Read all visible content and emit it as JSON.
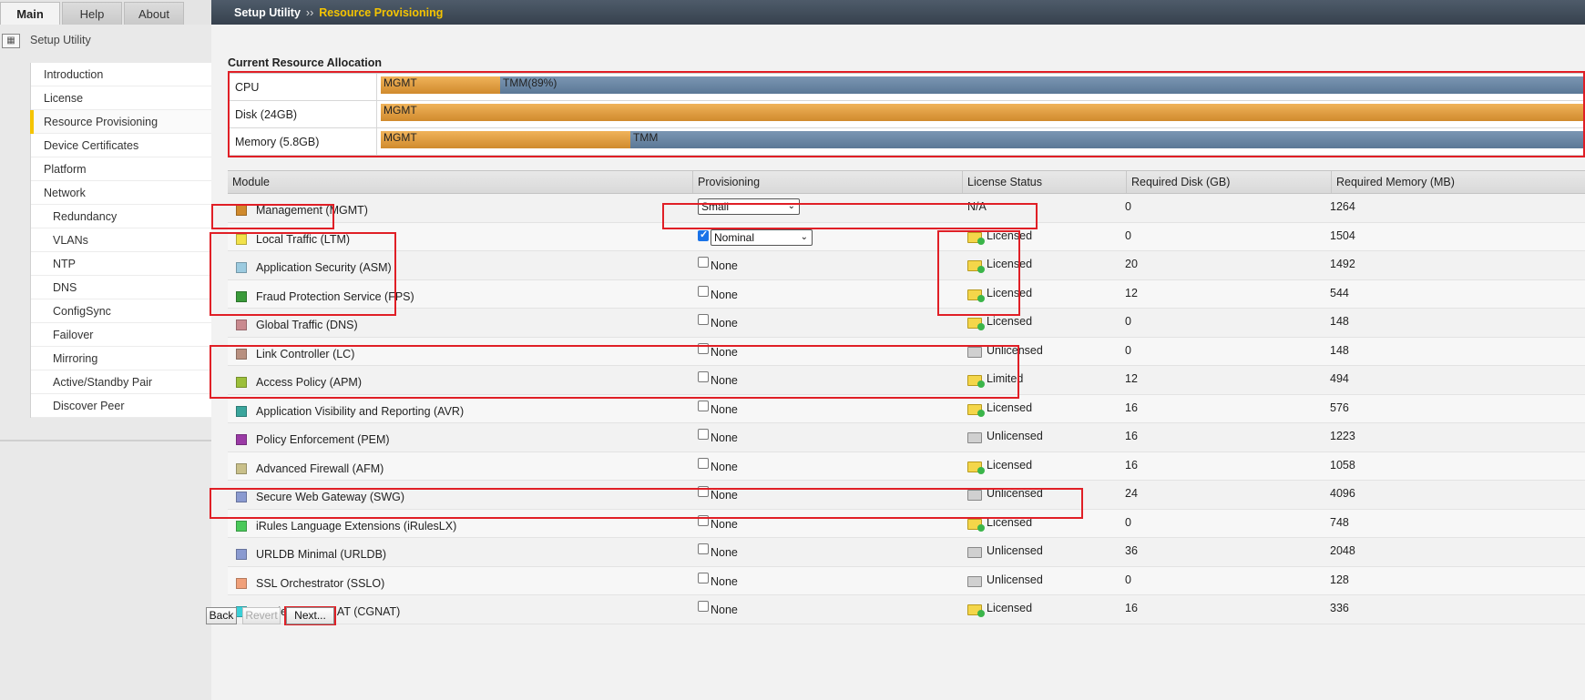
{
  "tabs": {
    "main": "Main",
    "help": "Help",
    "about": "About"
  },
  "sidebar": {
    "title": "Setup Utility",
    "items": [
      {
        "label": "Introduction"
      },
      {
        "label": "License"
      },
      {
        "label": "Resource Provisioning"
      },
      {
        "label": "Device Certificates"
      },
      {
        "label": "Platform"
      },
      {
        "label": "Network"
      },
      {
        "label": "Redundancy"
      },
      {
        "label": "VLANs"
      },
      {
        "label": "NTP"
      },
      {
        "label": "DNS"
      },
      {
        "label": "ConfigSync"
      },
      {
        "label": "Failover"
      },
      {
        "label": "Mirroring"
      },
      {
        "label": "Active/Standby Pair"
      },
      {
        "label": "Discover Peer"
      }
    ]
  },
  "header": {
    "root": "Setup Utility",
    "separator": "››",
    "current": "Resource Provisioning"
  },
  "allocation": {
    "title": "Current Resource Allocation",
    "rows": [
      {
        "label": "CPU",
        "mgmt_label": "MGMT",
        "tmm_label": "TMM(89%)"
      },
      {
        "label": "Disk (24GB)",
        "mgmt_label": "MGMT"
      },
      {
        "label": "Memory (5.8GB)",
        "mgmt_label": "MGMT",
        "tmm_label": "TMM"
      }
    ]
  },
  "table": {
    "headers": {
      "module": "Module",
      "provisioning": "Provisioning",
      "license": "License Status",
      "disk": "Required Disk (GB)",
      "memory": "Required Memory (MB)"
    },
    "rows": [
      {
        "name": "Management (MGMT)",
        "color": "#d08a2d",
        "select": "Small",
        "license": "N/A",
        "disk": "0",
        "memory": "1264"
      },
      {
        "name": "Local Traffic (LTM)",
        "color": "#f2e24a",
        "checked": true,
        "select": "Nominal",
        "license": "Licensed",
        "disk": "0",
        "memory": "1504"
      },
      {
        "name": "Application Security (ASM)",
        "color": "#9ccbe0",
        "prov": "None",
        "license": "Licensed",
        "disk": "20",
        "memory": "1492"
      },
      {
        "name": "Fraud Protection Service (FPS)",
        "color": "#3a9a3a",
        "prov": "None",
        "license": "Licensed",
        "disk": "12",
        "memory": "544"
      },
      {
        "name": "Global Traffic (DNS)",
        "color": "#c98a8f",
        "prov": "None",
        "license": "Licensed",
        "disk": "0",
        "memory": "148"
      },
      {
        "name": "Link Controller (LC)",
        "color": "#b89080",
        "prov": "None",
        "license": "Unlicensed",
        "disk": "0",
        "memory": "148"
      },
      {
        "name": "Access Policy (APM)",
        "color": "#9cbf3a",
        "prov": "None",
        "license": "Limited",
        "disk": "12",
        "memory": "494"
      },
      {
        "name": "Application Visibility and Reporting (AVR)",
        "color": "#3aa59c",
        "prov": "None",
        "license": "Licensed",
        "disk": "16",
        "memory": "576"
      },
      {
        "name": "Policy Enforcement (PEM)",
        "color": "#9a3aa5",
        "prov": "None",
        "license": "Unlicensed",
        "disk": "16",
        "memory": "1223"
      },
      {
        "name": "Advanced Firewall (AFM)",
        "color": "#c9c08a",
        "prov": "None",
        "license": "Licensed",
        "disk": "16",
        "memory": "1058"
      },
      {
        "name": "Secure Web Gateway (SWG)",
        "color": "#8a9ad0",
        "prov": "None",
        "license": "Unlicensed",
        "disk": "24",
        "memory": "4096"
      },
      {
        "name": "iRules Language Extensions (iRulesLX)",
        "color": "#4ac95a",
        "prov": "None",
        "license": "Licensed",
        "disk": "0",
        "memory": "748"
      },
      {
        "name": "URLDB Minimal (URLDB)",
        "color": "#8a9ad0",
        "prov": "None",
        "license": "Unlicensed",
        "disk": "36",
        "memory": "2048"
      },
      {
        "name": "SSL Orchestrator (SSLO)",
        "color": "#f0a07a",
        "prov": "None",
        "license": "Unlicensed",
        "disk": "0",
        "memory": "128"
      },
      {
        "name": "Carrier Grade NAT (CGNAT)",
        "color": "#3ad0d8",
        "prov": "None",
        "license": "Licensed",
        "disk": "16",
        "memory": "336"
      }
    ]
  },
  "buttons": {
    "back": "Back",
    "revert": "Revert",
    "next": "Next..."
  }
}
